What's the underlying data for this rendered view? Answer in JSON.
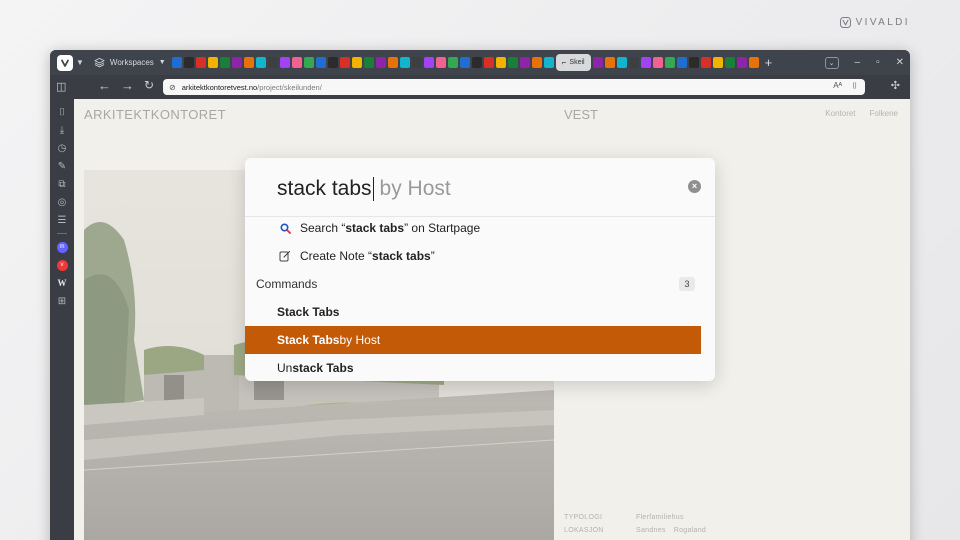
{
  "brand": {
    "name": "VIVALDI"
  },
  "browser": {
    "workspaces_label": "Workspaces",
    "active_tab_title": "Skeil",
    "favicon_colors": [
      "#1f6fd1",
      "#2b2b2b",
      "#d93025",
      "#f0b400",
      "#188038",
      "#8e24aa",
      "#e8710a",
      "#12b5cb",
      "#3c4043",
      "#a142f4",
      "#f06292",
      "#34a853"
    ],
    "address": {
      "host": "arkitektkontoretvest.no",
      "path": "/project/skeilunden/"
    }
  },
  "sidepanel": {
    "icons": [
      "bookmark-icon",
      "download-icon",
      "history-icon",
      "notes-icon",
      "tabs-icon",
      "window-icon",
      "reading-list-icon"
    ],
    "web_panels": [
      {
        "name": "mastodon-panel-icon",
        "color": "#6364ff",
        "glyph": "m"
      },
      {
        "name": "vivaldi-panel-icon",
        "color": "#ef3939",
        "glyph": "v"
      }
    ],
    "wiki_glyph": "W"
  },
  "site": {
    "logo": "ARKITEKTKONTORET",
    "vest": "VEST",
    "nav": [
      "Kontoret",
      "Folkene"
    ],
    "meta": [
      {
        "label": "TYPOLOGI",
        "values": [
          "Flerfamiliehus"
        ]
      },
      {
        "label": "LOKASJON",
        "values": [
          "Sandnes",
          "Rogaland"
        ]
      }
    ]
  },
  "palette": {
    "query": "stack tabs",
    "hint": "by Host",
    "search": {
      "prefix": "Search “",
      "term": "stack tabs",
      "suffix": "” on Startpage"
    },
    "note": {
      "prefix": "Create Note “",
      "term": "stack tabs",
      "suffix": "”"
    },
    "commands_header": "Commands",
    "commands_count": "3",
    "commands": [
      {
        "bold": "Stack Tabs",
        "rest": ""
      },
      {
        "bold": "Stack Tabs",
        "rest": " by Host"
      },
      {
        "pre": "Un",
        "bold": "stack Tabs",
        "rest": ""
      }
    ],
    "selected_color": "#c25a08"
  }
}
